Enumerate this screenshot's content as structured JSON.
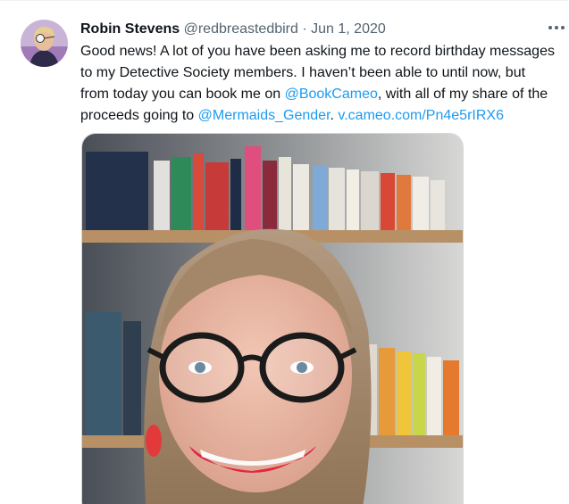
{
  "tweet": {
    "author_name": "Robin Stevens",
    "author_handle": "@redbreastedbird",
    "separator": "·",
    "date": "Jun 1, 2020",
    "text_line1": "Good news! A lot of you have been asking me to record birthday messages",
    "text_line2": "to my Detective Society members. I haven’t been able to until now, but",
    "text_line3a": "from today you can book me on ",
    "mention1": "@BookCameo",
    "text_line3b": ", with all of my share of the",
    "text_line4a": "proceeds going to ",
    "mention2": "@Mermaids_Gender",
    "text_line4b": ". ",
    "url": "v.cameo.com/Pn4e5rIRX6"
  },
  "icons": {
    "more": "more-options-icon"
  },
  "colors": {
    "link": "#1d9bf0",
    "name": "#0f1419",
    "secondary": "#536471"
  }
}
